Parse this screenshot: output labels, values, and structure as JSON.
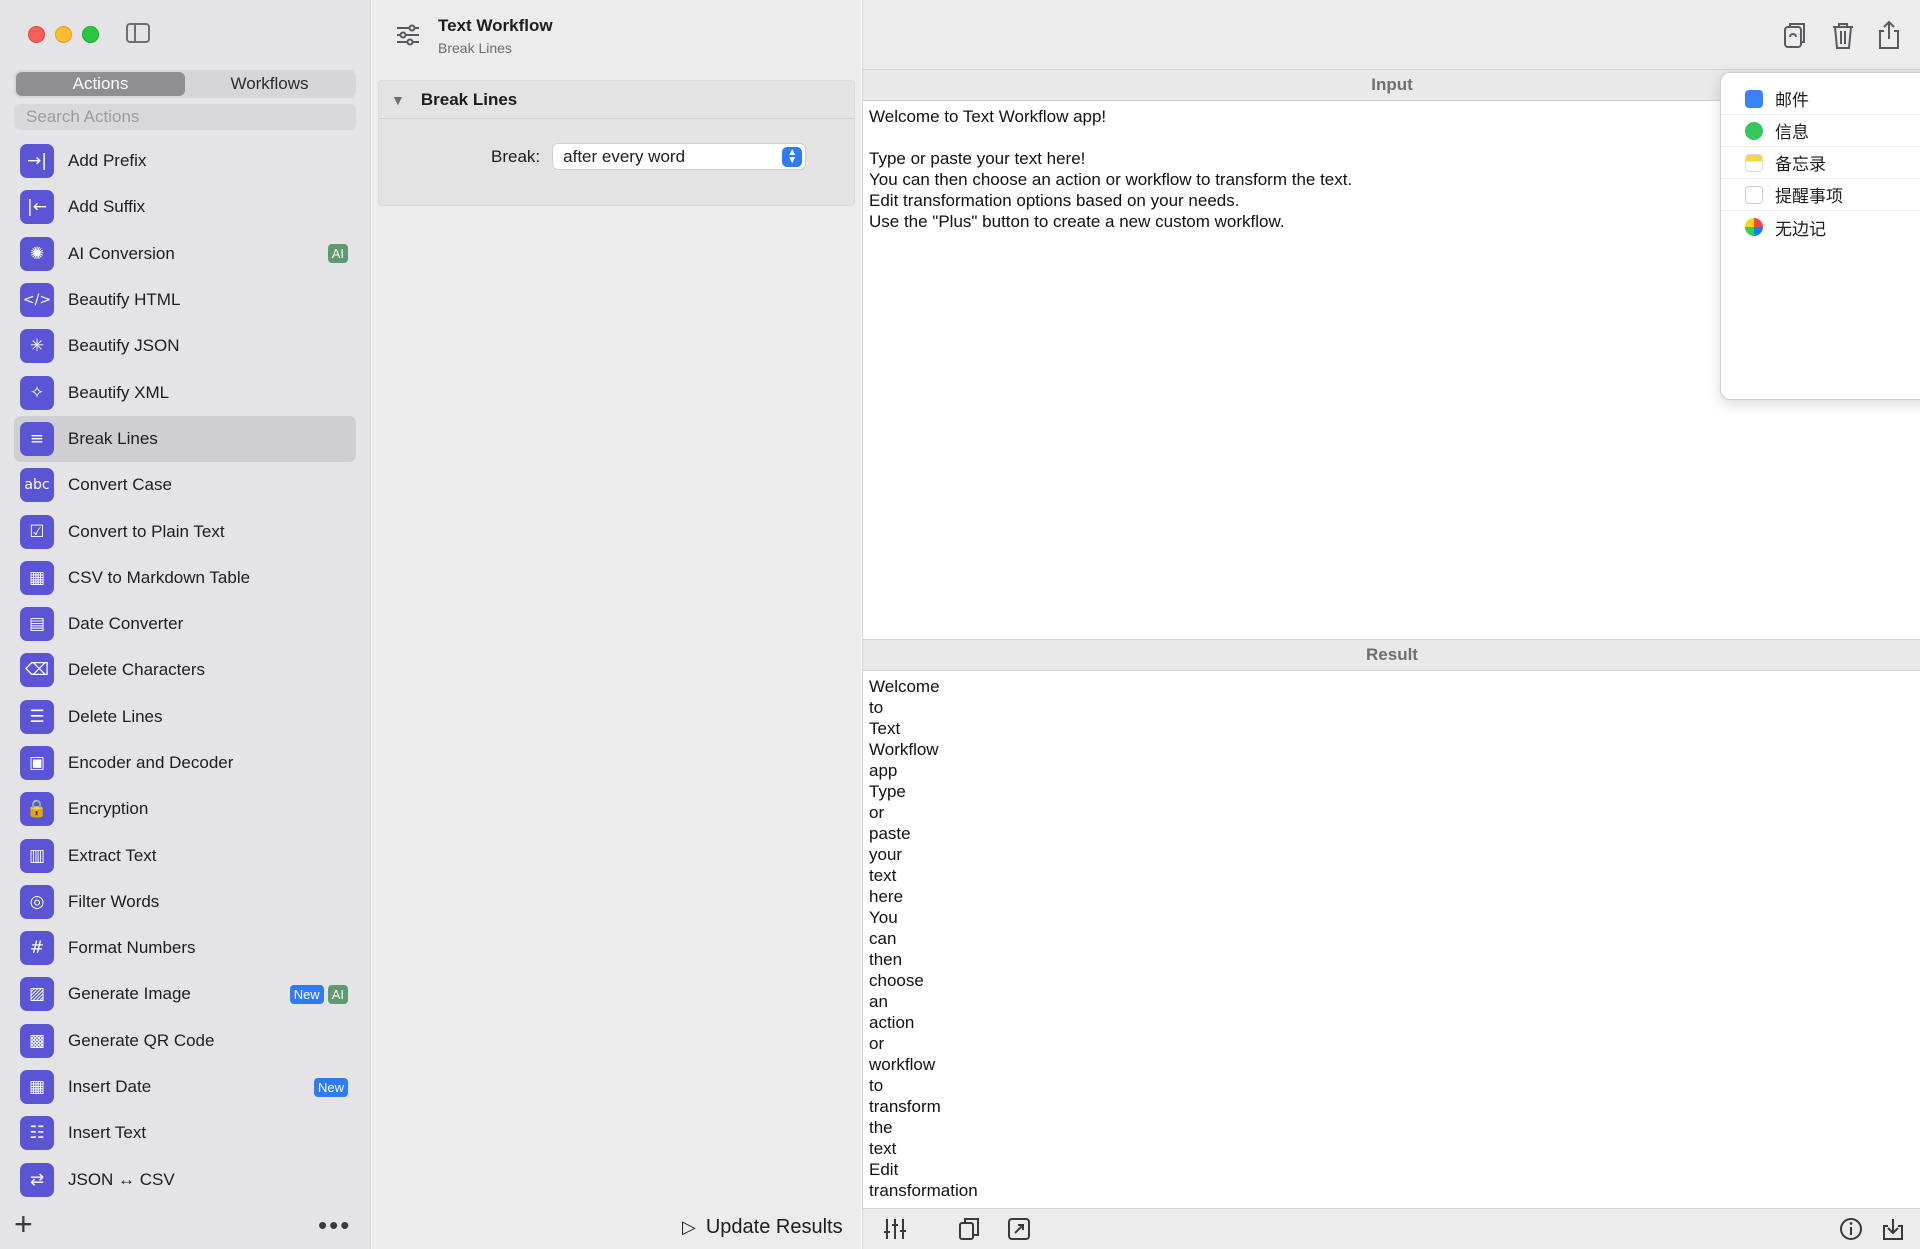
{
  "window": {
    "title": "Text Workflow",
    "subtitle": "Break Lines"
  },
  "sidebar": {
    "tabs": [
      {
        "label": "Actions",
        "active": true
      },
      {
        "label": "Workflows",
        "active": false
      }
    ],
    "search_placeholder": "Search Actions",
    "actions": [
      {
        "label": "Add Prefix",
        "icon": "→|"
      },
      {
        "label": "Add Suffix",
        "icon": "|←"
      },
      {
        "label": "AI Conversion",
        "icon": "✺",
        "badges": [
          "AI"
        ]
      },
      {
        "label": "Beautify HTML",
        "icon": "</>"
      },
      {
        "label": "Beautify JSON",
        "icon": "✳"
      },
      {
        "label": "Beautify XML",
        "icon": "✧"
      },
      {
        "label": "Break Lines",
        "icon": "≡",
        "selected": true
      },
      {
        "label": "Convert Case",
        "icon": "abc"
      },
      {
        "label": "Convert to Plain Text",
        "icon": "☑"
      },
      {
        "label": "CSV to Markdown Table",
        "icon": "▦"
      },
      {
        "label": "Date Converter",
        "icon": "▤"
      },
      {
        "label": "Delete Characters",
        "icon": "⌫"
      },
      {
        "label": "Delete Lines",
        "icon": "☰"
      },
      {
        "label": "Encoder and Decoder",
        "icon": "▣"
      },
      {
        "label": "Encryption",
        "icon": "🔒"
      },
      {
        "label": "Extract Text",
        "icon": "▥"
      },
      {
        "label": "Filter Words",
        "icon": "◎"
      },
      {
        "label": "Format Numbers",
        "icon": "#"
      },
      {
        "label": "Generate Image",
        "icon": "▨",
        "badges": [
          "New",
          "AI"
        ]
      },
      {
        "label": "Generate QR Code",
        "icon": "▩"
      },
      {
        "label": "Insert Date",
        "icon": "▦",
        "badges": [
          "New"
        ]
      },
      {
        "label": "Insert Text",
        "icon": "☷"
      },
      {
        "label": "JSON ↔ CSV",
        "icon": "⇄"
      }
    ],
    "add_label": "+",
    "more_label": "•••"
  },
  "options_panel": {
    "title": "Break Lines",
    "break_label": "Break:",
    "break_value": "after every word",
    "update_label": "Update Results"
  },
  "input": {
    "header": "Input",
    "text": "Welcome to Text Workflow app!\n\nType or paste your text here!\nYou can then choose an action or workflow to transform the text.\nEdit transformation options based on your needs.\nUse the \"Plus\" button to create a new custom workflow."
  },
  "result": {
    "header": "Result",
    "text": "Welcome\nto\nText\nWorkflow\napp\nType\nor\npaste\nyour\ntext\nhere\nYou\ncan\nthen\nchoose\nan\naction\nor\nworkflow\nto\ntransform\nthe\ntext\nEdit\ntransformation"
  },
  "share_menu": {
    "items": [
      "邮件",
      "信息",
      "备忘录",
      "提醒事项",
      "无边记"
    ]
  },
  "colors": {
    "accent": "#5b55d6",
    "new_badge": "#2f7bf5",
    "ai_badge": "#5d9a6f"
  }
}
